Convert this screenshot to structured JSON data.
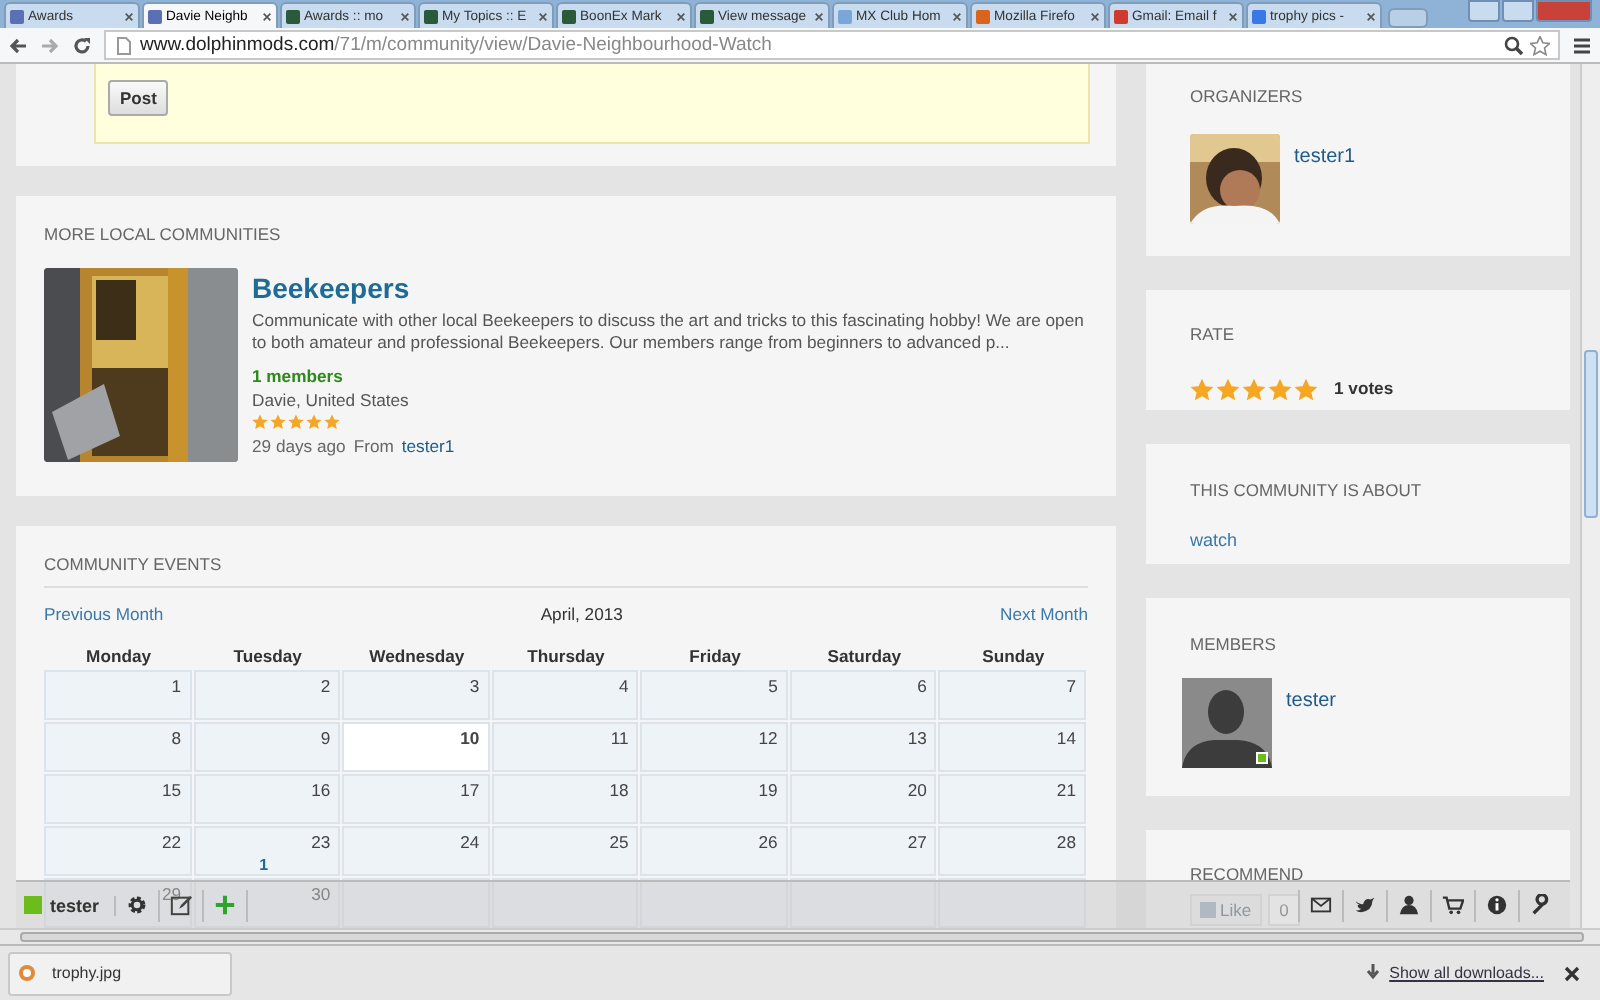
{
  "browser": {
    "tabs": [
      {
        "title": "Awards",
        "selected": false,
        "color": "#5b6fb5"
      },
      {
        "title": "Davie Neighb",
        "selected": true,
        "color": "#5b6fb5"
      },
      {
        "title": "Awards :: mo",
        "selected": false,
        "color": "#2a5a3a"
      },
      {
        "title": "My Topics :: E",
        "selected": false,
        "color": "#2a5a3a"
      },
      {
        "title": "BoonEx Mark",
        "selected": false,
        "color": "#2a5a3a"
      },
      {
        "title": "View message",
        "selected": false,
        "color": "#2a5a3a"
      },
      {
        "title": "MX Club Hom",
        "selected": false,
        "color": "#7aa7d8"
      },
      {
        "title": "Mozilla Firefo",
        "selected": false,
        "color": "#d8641e"
      },
      {
        "title": "Gmail: Email f",
        "selected": false,
        "color": "#d03b2f"
      },
      {
        "title": "trophy pics -",
        "selected": false,
        "color": "#3b78e7"
      }
    ],
    "url_host": "www.dolphinmods.com",
    "url_path": "/71/m/community/view/Davie-Neighbourhood-Watch"
  },
  "post_button": "Post",
  "local_communities": {
    "title": "MORE LOCAL COMMUNITIES",
    "items": [
      {
        "name": "Beekeepers",
        "description": "Communicate with other local Beekeepers to discuss the art and tricks to this fascinating hobby! We are open to both amateur and professional Beekeepers. Our members range from beginners to advanced p...",
        "members": "1 members",
        "location": "Davie, United States",
        "stars": 5,
        "age": "29 days ago",
        "from_label": "From",
        "author": "tester1"
      }
    ]
  },
  "events": {
    "title": "COMMUNITY EVENTS",
    "prev": "Previous Month",
    "month": "April, 2013",
    "next": "Next Month",
    "weekdays": [
      "Monday",
      "Tuesday",
      "Wednesday",
      "Thursday",
      "Friday",
      "Saturday",
      "Sunday"
    ],
    "weeks": [
      [
        {
          "day": "1",
          "today": false
        },
        {
          "day": "2",
          "today": false
        },
        {
          "day": "3",
          "today": false
        },
        {
          "day": "4",
          "today": false
        },
        {
          "day": "5",
          "today": false
        },
        {
          "day": "6",
          "today": false
        },
        {
          "day": "7",
          "today": false
        }
      ],
      [
        {
          "day": "8",
          "today": false
        },
        {
          "day": "9",
          "today": false
        },
        {
          "day": "10",
          "today": true
        },
        {
          "day": "11",
          "today": false
        },
        {
          "day": "12",
          "today": false
        },
        {
          "day": "13",
          "today": false
        },
        {
          "day": "14",
          "today": false
        }
      ],
      [
        {
          "day": "15",
          "today": false
        },
        {
          "day": "16",
          "today": false
        },
        {
          "day": "17",
          "today": false
        },
        {
          "day": "18",
          "today": false
        },
        {
          "day": "19",
          "today": false
        },
        {
          "day": "20",
          "today": false
        },
        {
          "day": "21",
          "today": false
        }
      ],
      [
        {
          "day": "22",
          "today": false
        },
        {
          "day": "23",
          "today": false,
          "events": "1"
        },
        {
          "day": "24",
          "today": false
        },
        {
          "day": "25",
          "today": false
        },
        {
          "day": "26",
          "today": false
        },
        {
          "day": "27",
          "today": false
        },
        {
          "day": "28",
          "today": false
        }
      ],
      [
        {
          "day": "29",
          "today": false
        },
        {
          "day": "30",
          "today": false
        }
      ]
    ]
  },
  "organizers": {
    "title": "ORGANIZERS",
    "people": [
      {
        "name": "tester1"
      }
    ]
  },
  "rate": {
    "title": "RATE",
    "stars": 5,
    "votes": "1 votes"
  },
  "about": {
    "title": "THIS COMMUNITY IS ABOUT",
    "tags": [
      "watch"
    ]
  },
  "members": {
    "title": "MEMBERS",
    "people": [
      {
        "name": "tester",
        "online": true
      }
    ]
  },
  "recommend": {
    "title": "RECOMMEND",
    "like": "Like",
    "like_count": "0"
  },
  "toolbar": {
    "user": "tester",
    "online": true
  },
  "downloads": {
    "items": [
      "trophy.jpg"
    ],
    "show_all": "Show all downloads..."
  }
}
